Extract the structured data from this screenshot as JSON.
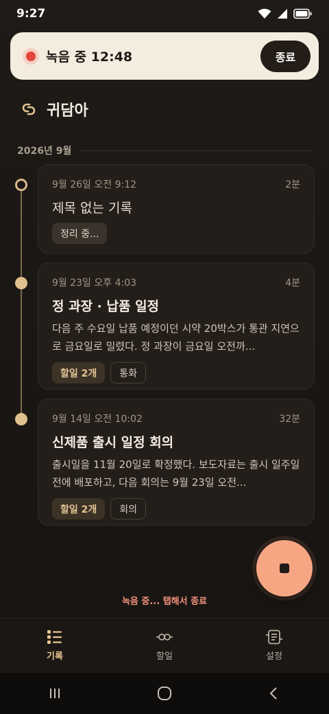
{
  "status_bar": {
    "time": "9:27"
  },
  "recording_banner": {
    "status_text": "녹음 중 12:48",
    "stop_label": "종료"
  },
  "app": {
    "title": "귀담아"
  },
  "month_header": "2026년 9월",
  "recordings": [
    {
      "date": "9월 26일 오전 9:12",
      "duration": "2분",
      "title": "제목 없는 기록",
      "summary": "",
      "status_chip": "정리 중..."
    },
    {
      "date": "9월 23일 오후 4:03",
      "duration": "4분",
      "title": "정 과장 · 납품 일정",
      "summary": "다음 주 수요일 납품 예정이던 시약 20박스가 통관 지연으로 금요일로 밀렸다. 정 과장이 금요일 오전까...",
      "todo_chip": "할일 2개",
      "tag_chip": "통화"
    },
    {
      "date": "9월 14일 오전 10:02",
      "duration": "32분",
      "title": "신제품 출시 일정 회의",
      "summary": "출시일을 11월 20일로 확정했다. 보도자료는 출시 일주일 전에 배포하고, 다음 회의는 9월 23일 오전...",
      "todo_chip": "할일 2개",
      "tag_chip": "회의"
    }
  ],
  "fab_hint": "녹음 중... 탭해서 종료",
  "bottom_nav": {
    "records": "기록",
    "todos": "할일",
    "settings": "설정"
  },
  "colors": {
    "accent": "#e8c893",
    "recording_red": "#e4453a",
    "fab": "#f7a684"
  }
}
